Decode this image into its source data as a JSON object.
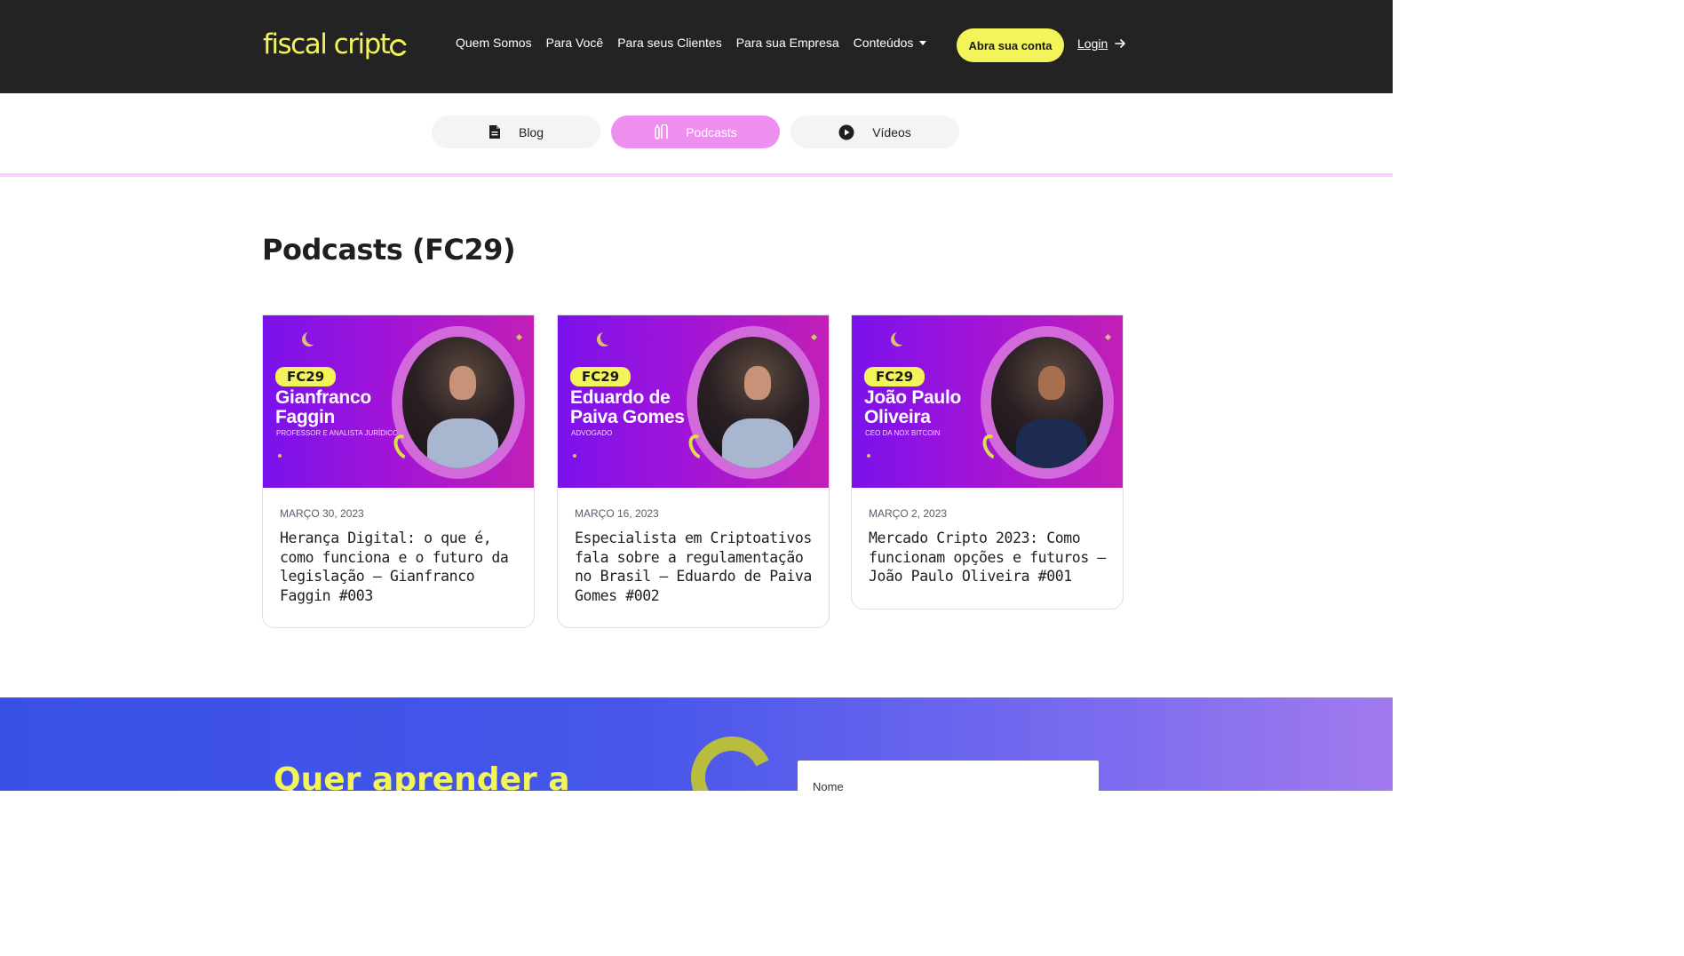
{
  "header": {
    "logo_text_main": "fiscal cript",
    "nav": [
      "Quem Somos",
      "Para Você",
      "Para seus Clientes",
      "Para sua Empresa",
      "Conteúdos"
    ],
    "cta_label": "Abra sua conta",
    "login_label": "Login"
  },
  "tabs": [
    {
      "label": "Blog",
      "icon": "document-icon",
      "active": false
    },
    {
      "label": "Podcasts",
      "icon": "microphone-icon",
      "active": true
    },
    {
      "label": "Vídeos",
      "icon": "play-icon",
      "active": false
    }
  ],
  "section_title": "Podcasts (FC29)",
  "cards": [
    {
      "badge": "FC29",
      "guest_name": "Gianfranco Faggin",
      "guest_role": "PROFESSOR E ANALISTA JURÍDICO",
      "date": "MARÇO 30, 2023",
      "title": "Herança Digital: o que é, como funciona e o futuro da legislação – Gianfranco Faggin #003"
    },
    {
      "badge": "FC29",
      "guest_name": "Eduardo de Paiva Gomes",
      "guest_role": "ADVOGADO",
      "date": "MARÇO 16, 2023",
      "title": "Especialista em Criptoativos fala sobre a regulamentação no Brasil – Eduardo de Paiva Gomes #002"
    },
    {
      "badge": "FC29",
      "guest_name": "João Paulo Oliveira",
      "guest_role": "CEO DA NOX BITCOIN",
      "date": "MARÇO 2, 2023",
      "title": "Mercado Cripto 2023: Como funcionam opções e futuros – João Paulo Oliveira #001"
    }
  ],
  "newsletter": {
    "title": "Quer aprender a",
    "name_placeholder": "Nome"
  },
  "colors": {
    "header_bg": "#232323",
    "brand_yellow": "#f2f45a",
    "tab_active": "#ee8ff0",
    "band_start": "#3950e6",
    "band_end": "#a27aee"
  }
}
